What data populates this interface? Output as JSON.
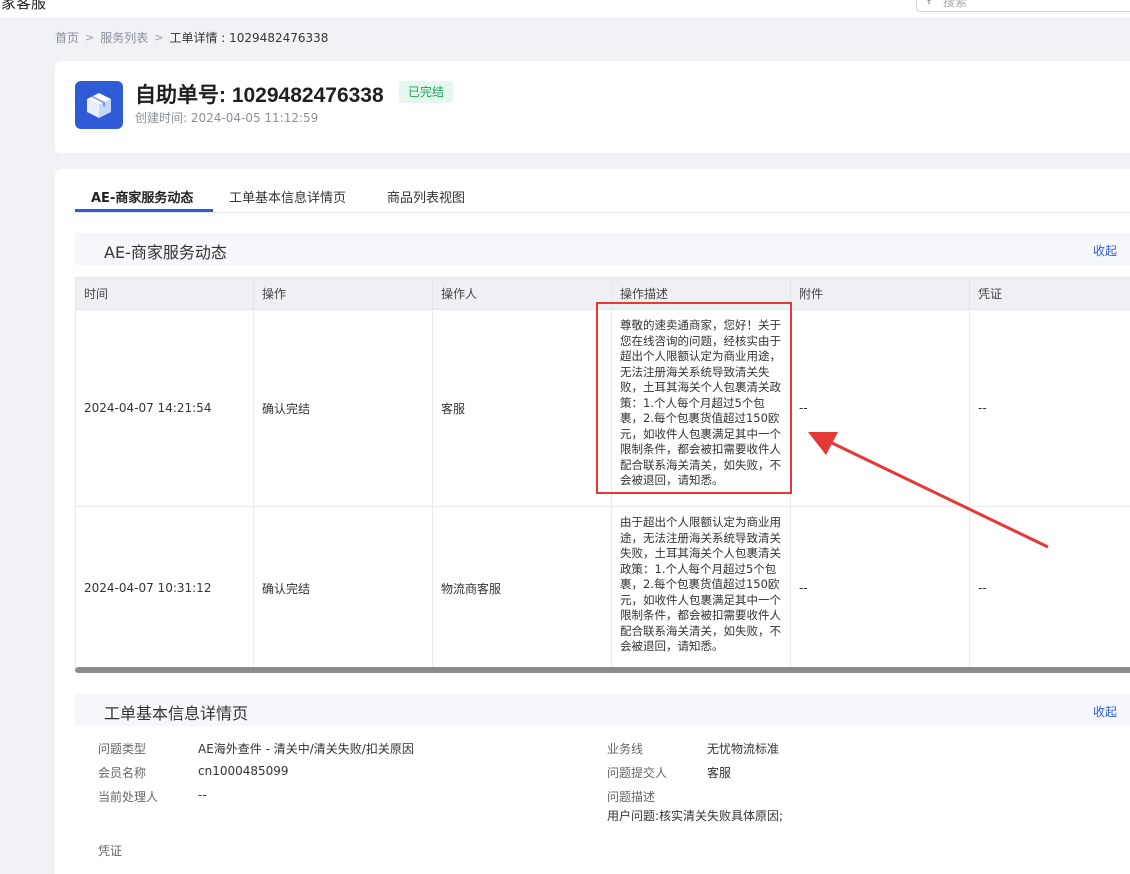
{
  "app": {
    "title": "商家客服"
  },
  "search": {
    "placeholder": "搜索"
  },
  "breadcrumb": {
    "home": "首页",
    "list": "服务列表",
    "current": "工单详情 : 1029482476338"
  },
  "header": {
    "title": "自助单号: 1029482476338",
    "status": "已完结",
    "created": "创建时间: 2024-04-05 11:12:59"
  },
  "tabs": [
    "AE-商家服务动态",
    "工单基本信息详情页",
    "商品列表视图"
  ],
  "dynamics": {
    "title": "AE-商家服务动态",
    "collapse": "收起",
    "columns": [
      "时间",
      "操作",
      "操作人",
      "操作描述",
      "附件",
      "凭证"
    ],
    "rows": [
      {
        "time": "2024-04-07 14:21:54",
        "action": "确认完结",
        "operator": "客服",
        "desc": "尊敬的速卖通商家，您好！关于您在线咨询的问题，经核实由于超出个人限额认定为商业用途，无法注册海关系统导致清关失败，土耳其海关个人包裹清关政策：1.个人每个月超过5个包裹，2.每个包裹货值超过150欧元，如收件人包裹满足其中一个限制条件，都会被扣需要收件人配合联系海关清关，如失败，不会被退回，请知悉。",
        "attachment": "--",
        "voucher": "--"
      },
      {
        "time": "2024-04-07 10:31:12",
        "action": "确认完结",
        "operator": "物流商客服",
        "desc": "由于超出个人限额认定为商业用途，无法注册海关系统导致清关失败，土耳其海关个人包裹清关政策：1.个人每个月超过5个包裹，2.每个包裹货值超过150欧元，如收件人包裹满足其中一个限制条件，都会被扣需要收件人配合联系海关清关，如失败，不会被退回，请知悉。",
        "attachment": "--",
        "voucher": "--"
      }
    ]
  },
  "basic_info": {
    "title": "工单基本信息详情页",
    "collapse": "收起",
    "problem_type_label": "问题类型",
    "problem_type": "AE海外查件 - 清关中/清关失败/扣关原因",
    "member_label": "会员名称",
    "member": "cn1000485099",
    "handler_label": "当前处理人",
    "handler": "--",
    "business_label": "业务线",
    "business": "无忧物流标准",
    "submitter_label": "问题提交人",
    "submitter": "客服",
    "desc_label": "问题描述",
    "desc": "用户问题:核实清关失败具体原因;",
    "voucher_label": "凭证"
  },
  "colors": {
    "accent": "#2f5bd6",
    "success": "#1aa35a",
    "annotation": "#e53935"
  }
}
